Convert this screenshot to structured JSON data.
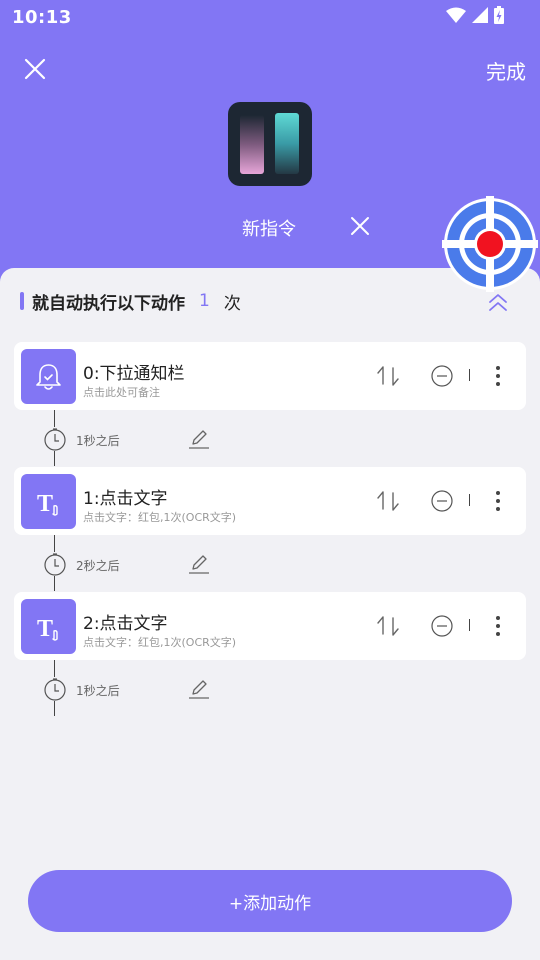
{
  "status_bar": {
    "time": "10:13"
  },
  "header": {
    "done_label": "完成",
    "macro_name": "新指令",
    "icons": {
      "close": "close-icon",
      "rename_clear": "close-icon",
      "record": "record-target-icon"
    }
  },
  "section": {
    "title": "就自动执行以下动作",
    "repeat_count": "1",
    "repeat_unit": "次"
  },
  "actions": [
    {
      "title": "0:下拉通知栏",
      "subtitle": "点击此处可备注",
      "icon": "bell-icon",
      "delay": "1秒之后"
    },
    {
      "title": "1:点击文字",
      "subtitle": "点击文字：红包,1次(OCR文字)",
      "icon": "text-tap-icon",
      "delay": "2秒之后"
    },
    {
      "title": "2:点击文字",
      "subtitle": "点击文字：红包,1次(OCR文字)",
      "icon": "text-tap-icon",
      "delay": "1秒之后"
    }
  ],
  "add_button": {
    "label": "+添加动作"
  },
  "colors": {
    "accent": "#8276f4",
    "record_blue": "#4a7bea",
    "record_red": "#f11220"
  }
}
